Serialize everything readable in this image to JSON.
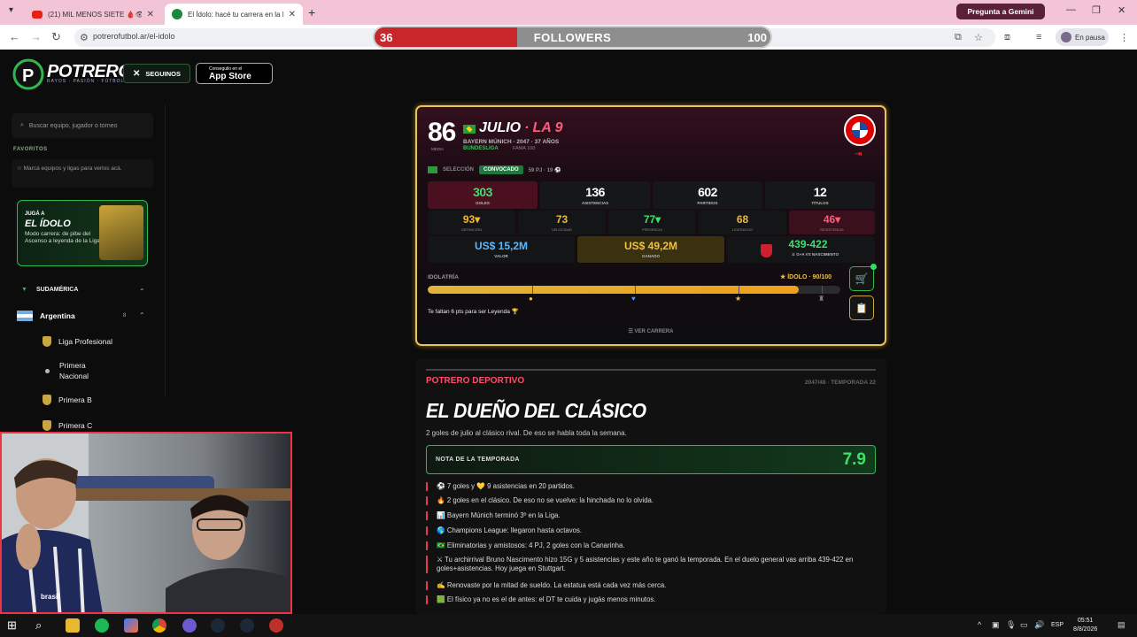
{
  "browser": {
    "tabs": [
      {
        "title": "(21) MIL MENOS SIETE 🩸👁 | ..."
      },
      {
        "title": "El Ídolo: hacé tu carrera en la L..."
      }
    ],
    "url": "potrerofutbol.ar/el-idolo",
    "gemini_label": "Pregunta a Gemini",
    "profile_label": "En pausa"
  },
  "followers_overlay": {
    "current": "36",
    "label": "FOLLOWERS",
    "goal": "100",
    "progress": 0.36
  },
  "site": {
    "brand": "POTRERO",
    "tagline": "RAYOS · PASIÓN · FÚTBOL",
    "x_button": "SEGUINOS",
    "appstore_small": "Conseguilo en el",
    "appstore_big": "App Store"
  },
  "sidebar": {
    "search_placeholder": "Buscar equipo, jugador o torneo",
    "favorites_heading": "FAVORITOS",
    "favorites_note": "Marcá equipos y ligas para verlos acá.",
    "promo": {
      "kicker": "JUGÁ A",
      "title": "EL ÍDOLO",
      "text": "Modo carrera: de pibe del Ascenso a leyenda de la Liga"
    },
    "region": "SUDAMÉRICA",
    "country": "Argentina",
    "country_count": "8",
    "leagues": [
      "Liga Profesional",
      "Primera Nacional",
      "Primera B",
      "Primera C"
    ]
  },
  "webcam": {
    "tag": "brasil"
  },
  "player": {
    "overall": "86",
    "overall_label": "MEDIA",
    "first_name": "JULIO",
    "separator": "·",
    "position": "LA 9",
    "club_line": "BAYERN MÚNICH · 2047 · 37 AÑOS",
    "league": "BUNDESLIGA",
    "fama": "FAMA 100",
    "seleccion_label": "SELECCIÓN",
    "convocado": "CONVOCADO",
    "caps": "59 PJ · 19 ⚽",
    "stats": [
      {
        "value": "303",
        "label": "GOLES"
      },
      {
        "value": "136",
        "label": "ASISTENCIAS"
      },
      {
        "value": "602",
        "label": "PARTIDOS"
      },
      {
        "value": "12",
        "label": "TÍTULOS"
      }
    ],
    "attributes": [
      {
        "value": "93▾",
        "label": "DEFINICIÓN",
        "color": "#f0b83a"
      },
      {
        "value": "73",
        "label": "VELOCIDAD",
        "color": "#f0b83a"
      },
      {
        "value": "77▾",
        "label": "PRESENCIA",
        "color": "#3ee06a"
      },
      {
        "value": "68",
        "label": "LIDERAZGO",
        "color": "#f0b83a"
      },
      {
        "value": "46▾",
        "label": "RESISTENCIA",
        "color": "#ff5a7a"
      }
    ],
    "money": [
      {
        "value": "US$ 15,2M",
        "label": "VALOR",
        "color": "#5ab8ff"
      },
      {
        "value": "US$ 49,2M",
        "label": "GANADO",
        "color": "#f0c040"
      },
      {
        "value": "439-422",
        "label": "⚔ G+A VS NASCIMENTO",
        "color": "#3ee06a"
      }
    ],
    "idolatria_label": "IDOLATRÍA",
    "idolatria_value": "★ ÍDOLO · 90/100",
    "idolatria": 90,
    "faltan": "Te faltan 6 pts para ser Leyenda 🏆",
    "ver_carrera": "☰ VER CARRERA"
  },
  "article": {
    "section": "POTRERO DEPORTIVO",
    "season": "2047/48 · TEMPORADA 22",
    "headline": "EL DUEÑO DEL CLÁSICO",
    "subheadline": "2 goles de julio al clásico rival. De eso se habla toda la semana.",
    "rating_label": "NOTA DE LA TEMPORADA",
    "rating": "7.9",
    "items": [
      "⚽ 7 goles y 💛 9 asistencias en 20 partidos.",
      "🔥 2 goles en el clásico. De eso no se vuelve: la hinchada no lo olvida.",
      "📊 Bayern Múnich terminó 3º en la Liga.",
      "🌎 Champions League: llegaron hasta octavos.",
      "🇧🇷 Eliminatorias y amistosos: 4 PJ, 2 goles con la Canarinha.",
      "⚔ Tu archirrival Bruno Nascimento hizo 15G y 5 asistencias y este año te ganó la temporada. En el duelo general vas arriba 439-422 en goles+asistencias. Hoy juega en Stuttgart.",
      "✍ Renovaste por la mitad de sueldo. La estatua está cada vez más cerca.",
      "🟩 El físico ya no es el de antes: el DT te cuida y jugás menos minutos."
    ]
  },
  "taskbar": {
    "time": "05:51",
    "date": "8/8/2026",
    "lang": "ESP"
  }
}
